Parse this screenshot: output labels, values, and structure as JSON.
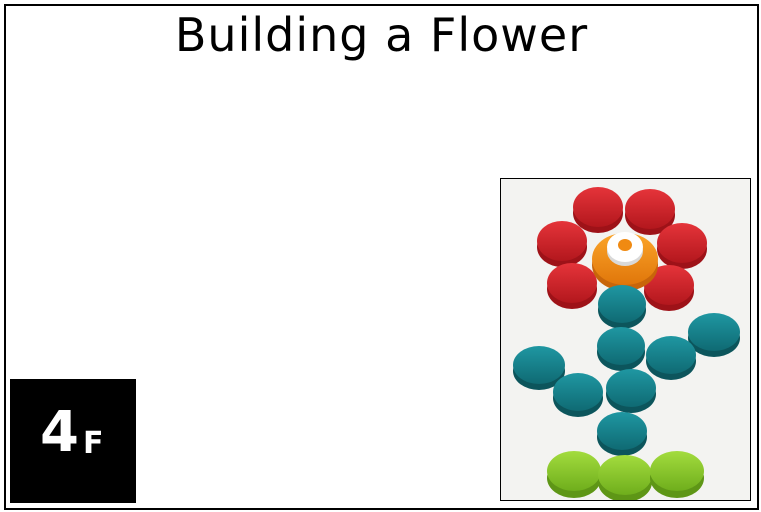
{
  "title": "Building a Flower",
  "badge": {
    "number": "4",
    "letter": "F"
  },
  "photo": {
    "icon": "flower-made-of-bottle-caps",
    "colors": {
      "petal": "#d7282f",
      "center_outer": "#f08a12",
      "center_inner": "#ffffff",
      "stem_leaves": "#16818c",
      "grass": "#8ccc2c",
      "background": "#f3f3f1"
    }
  }
}
